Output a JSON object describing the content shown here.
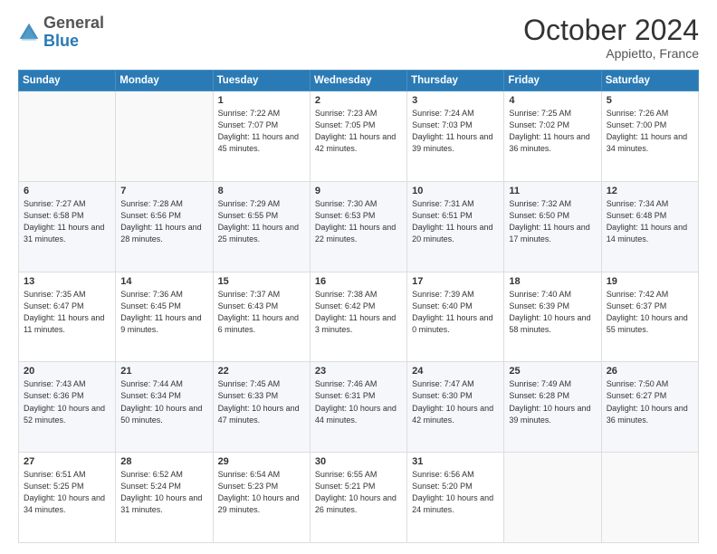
{
  "header": {
    "logo": {
      "general": "General",
      "blue": "Blue"
    },
    "title": "October 2024",
    "location": "Appietto, France"
  },
  "days_of_week": [
    "Sunday",
    "Monday",
    "Tuesday",
    "Wednesday",
    "Thursday",
    "Friday",
    "Saturday"
  ],
  "weeks": [
    [
      {
        "day": "",
        "sunrise": "",
        "sunset": "",
        "daylight": ""
      },
      {
        "day": "",
        "sunrise": "",
        "sunset": "",
        "daylight": ""
      },
      {
        "day": "1",
        "sunrise": "Sunrise: 7:22 AM",
        "sunset": "Sunset: 7:07 PM",
        "daylight": "Daylight: 11 hours and 45 minutes."
      },
      {
        "day": "2",
        "sunrise": "Sunrise: 7:23 AM",
        "sunset": "Sunset: 7:05 PM",
        "daylight": "Daylight: 11 hours and 42 minutes."
      },
      {
        "day": "3",
        "sunrise": "Sunrise: 7:24 AM",
        "sunset": "Sunset: 7:03 PM",
        "daylight": "Daylight: 11 hours and 39 minutes."
      },
      {
        "day": "4",
        "sunrise": "Sunrise: 7:25 AM",
        "sunset": "Sunset: 7:02 PM",
        "daylight": "Daylight: 11 hours and 36 minutes."
      },
      {
        "day": "5",
        "sunrise": "Sunrise: 7:26 AM",
        "sunset": "Sunset: 7:00 PM",
        "daylight": "Daylight: 11 hours and 34 minutes."
      }
    ],
    [
      {
        "day": "6",
        "sunrise": "Sunrise: 7:27 AM",
        "sunset": "Sunset: 6:58 PM",
        "daylight": "Daylight: 11 hours and 31 minutes."
      },
      {
        "day": "7",
        "sunrise": "Sunrise: 7:28 AM",
        "sunset": "Sunset: 6:56 PM",
        "daylight": "Daylight: 11 hours and 28 minutes."
      },
      {
        "day": "8",
        "sunrise": "Sunrise: 7:29 AM",
        "sunset": "Sunset: 6:55 PM",
        "daylight": "Daylight: 11 hours and 25 minutes."
      },
      {
        "day": "9",
        "sunrise": "Sunrise: 7:30 AM",
        "sunset": "Sunset: 6:53 PM",
        "daylight": "Daylight: 11 hours and 22 minutes."
      },
      {
        "day": "10",
        "sunrise": "Sunrise: 7:31 AM",
        "sunset": "Sunset: 6:51 PM",
        "daylight": "Daylight: 11 hours and 20 minutes."
      },
      {
        "day": "11",
        "sunrise": "Sunrise: 7:32 AM",
        "sunset": "Sunset: 6:50 PM",
        "daylight": "Daylight: 11 hours and 17 minutes."
      },
      {
        "day": "12",
        "sunrise": "Sunrise: 7:34 AM",
        "sunset": "Sunset: 6:48 PM",
        "daylight": "Daylight: 11 hours and 14 minutes."
      }
    ],
    [
      {
        "day": "13",
        "sunrise": "Sunrise: 7:35 AM",
        "sunset": "Sunset: 6:47 PM",
        "daylight": "Daylight: 11 hours and 11 minutes."
      },
      {
        "day": "14",
        "sunrise": "Sunrise: 7:36 AM",
        "sunset": "Sunset: 6:45 PM",
        "daylight": "Daylight: 11 hours and 9 minutes."
      },
      {
        "day": "15",
        "sunrise": "Sunrise: 7:37 AM",
        "sunset": "Sunset: 6:43 PM",
        "daylight": "Daylight: 11 hours and 6 minutes."
      },
      {
        "day": "16",
        "sunrise": "Sunrise: 7:38 AM",
        "sunset": "Sunset: 6:42 PM",
        "daylight": "Daylight: 11 hours and 3 minutes."
      },
      {
        "day": "17",
        "sunrise": "Sunrise: 7:39 AM",
        "sunset": "Sunset: 6:40 PM",
        "daylight": "Daylight: 11 hours and 0 minutes."
      },
      {
        "day": "18",
        "sunrise": "Sunrise: 7:40 AM",
        "sunset": "Sunset: 6:39 PM",
        "daylight": "Daylight: 10 hours and 58 minutes."
      },
      {
        "day": "19",
        "sunrise": "Sunrise: 7:42 AM",
        "sunset": "Sunset: 6:37 PM",
        "daylight": "Daylight: 10 hours and 55 minutes."
      }
    ],
    [
      {
        "day": "20",
        "sunrise": "Sunrise: 7:43 AM",
        "sunset": "Sunset: 6:36 PM",
        "daylight": "Daylight: 10 hours and 52 minutes."
      },
      {
        "day": "21",
        "sunrise": "Sunrise: 7:44 AM",
        "sunset": "Sunset: 6:34 PM",
        "daylight": "Daylight: 10 hours and 50 minutes."
      },
      {
        "day": "22",
        "sunrise": "Sunrise: 7:45 AM",
        "sunset": "Sunset: 6:33 PM",
        "daylight": "Daylight: 10 hours and 47 minutes."
      },
      {
        "day": "23",
        "sunrise": "Sunrise: 7:46 AM",
        "sunset": "Sunset: 6:31 PM",
        "daylight": "Daylight: 10 hours and 44 minutes."
      },
      {
        "day": "24",
        "sunrise": "Sunrise: 7:47 AM",
        "sunset": "Sunset: 6:30 PM",
        "daylight": "Daylight: 10 hours and 42 minutes."
      },
      {
        "day": "25",
        "sunrise": "Sunrise: 7:49 AM",
        "sunset": "Sunset: 6:28 PM",
        "daylight": "Daylight: 10 hours and 39 minutes."
      },
      {
        "day": "26",
        "sunrise": "Sunrise: 7:50 AM",
        "sunset": "Sunset: 6:27 PM",
        "daylight": "Daylight: 10 hours and 36 minutes."
      }
    ],
    [
      {
        "day": "27",
        "sunrise": "Sunrise: 6:51 AM",
        "sunset": "Sunset: 5:25 PM",
        "daylight": "Daylight: 10 hours and 34 minutes."
      },
      {
        "day": "28",
        "sunrise": "Sunrise: 6:52 AM",
        "sunset": "Sunset: 5:24 PM",
        "daylight": "Daylight: 10 hours and 31 minutes."
      },
      {
        "day": "29",
        "sunrise": "Sunrise: 6:54 AM",
        "sunset": "Sunset: 5:23 PM",
        "daylight": "Daylight: 10 hours and 29 minutes."
      },
      {
        "day": "30",
        "sunrise": "Sunrise: 6:55 AM",
        "sunset": "Sunset: 5:21 PM",
        "daylight": "Daylight: 10 hours and 26 minutes."
      },
      {
        "day": "31",
        "sunrise": "Sunrise: 6:56 AM",
        "sunset": "Sunset: 5:20 PM",
        "daylight": "Daylight: 10 hours and 24 minutes."
      },
      {
        "day": "",
        "sunrise": "",
        "sunset": "",
        "daylight": ""
      },
      {
        "day": "",
        "sunrise": "",
        "sunset": "",
        "daylight": ""
      }
    ]
  ]
}
